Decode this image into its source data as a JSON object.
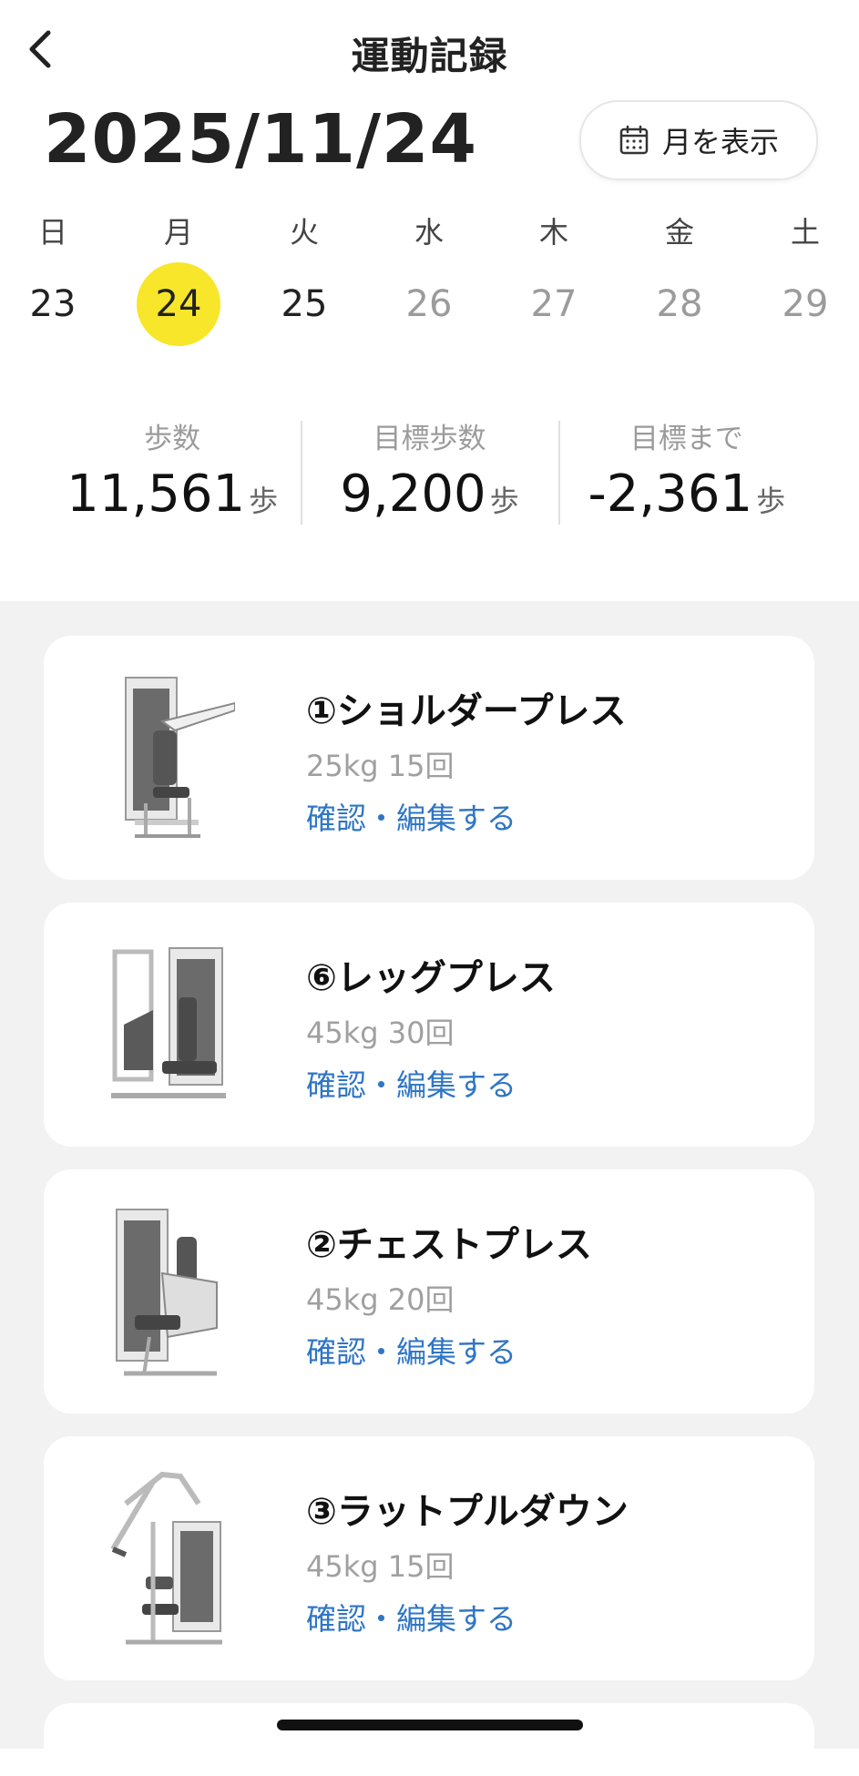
{
  "header": {
    "title": "運動記録",
    "back_icon": "chevron-left-icon"
  },
  "date": {
    "current": "2025/11/24",
    "month_button_label": "月を表示",
    "month_button_icon": "calendar-icon"
  },
  "week": {
    "days": [
      {
        "dow": "日",
        "num": "23",
        "state": "past"
      },
      {
        "dow": "月",
        "num": "24",
        "state": "selected"
      },
      {
        "dow": "火",
        "num": "25",
        "state": "past"
      },
      {
        "dow": "水",
        "num": "26",
        "state": "future"
      },
      {
        "dow": "木",
        "num": "27",
        "state": "future"
      },
      {
        "dow": "金",
        "num": "28",
        "state": "future"
      },
      {
        "dow": "土",
        "num": "29",
        "state": "future"
      }
    ],
    "selected_color": "#f7e62a"
  },
  "stats": [
    {
      "label": "歩数",
      "value": "11,561",
      "unit": "歩"
    },
    {
      "label": "目標歩数",
      "value": "9,200",
      "unit": "歩"
    },
    {
      "label": "目標まで",
      "value": "-2,361",
      "unit": "歩"
    }
  ],
  "workouts": [
    {
      "name": "①ショルダープレス",
      "meta": "25kg 15回",
      "action": "確認・編集する",
      "image": "shoulder-press-machine"
    },
    {
      "name": "⑥レッグプレス",
      "meta": "45kg 30回",
      "action": "確認・編集する",
      "image": "leg-press-machine"
    },
    {
      "name": "②チェストプレス",
      "meta": "45kg 20回",
      "action": "確認・編集する",
      "image": "chest-press-machine"
    },
    {
      "name": "③ラットプルダウン",
      "meta": "45kg 15回",
      "action": "確認・編集する",
      "image": "lat-pulldown-machine"
    }
  ],
  "colors": {
    "link": "#2f76c4",
    "muted": "#a0a0a0",
    "background_list": "#f2f2f2"
  }
}
